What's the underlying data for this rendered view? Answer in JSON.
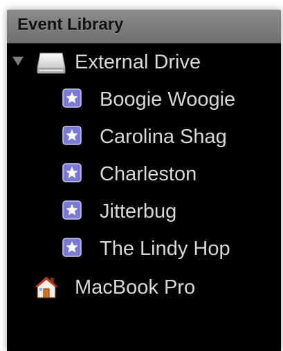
{
  "sidebar": {
    "title": "Event Library",
    "drive": {
      "label": "External Drive",
      "icon": "external-drive-icon",
      "expanded": true,
      "events": [
        {
          "label": "Boogie Woogie",
          "icon": "event-star-icon"
        },
        {
          "label": "Carolina Shag",
          "icon": "event-star-icon"
        },
        {
          "label": "Charleston",
          "icon": "event-star-icon"
        },
        {
          "label": "Jitterbug",
          "icon": "event-star-icon"
        },
        {
          "label": "The Lindy Hop",
          "icon": "event-star-icon"
        }
      ]
    },
    "computer": {
      "label": "MacBook Pro",
      "icon": "home-icon"
    }
  },
  "colors": {
    "panel_background": "#000000",
    "header_background": "#7d7d7d",
    "text": "#d8d8d8",
    "star_badge": "#7b7bd6"
  }
}
